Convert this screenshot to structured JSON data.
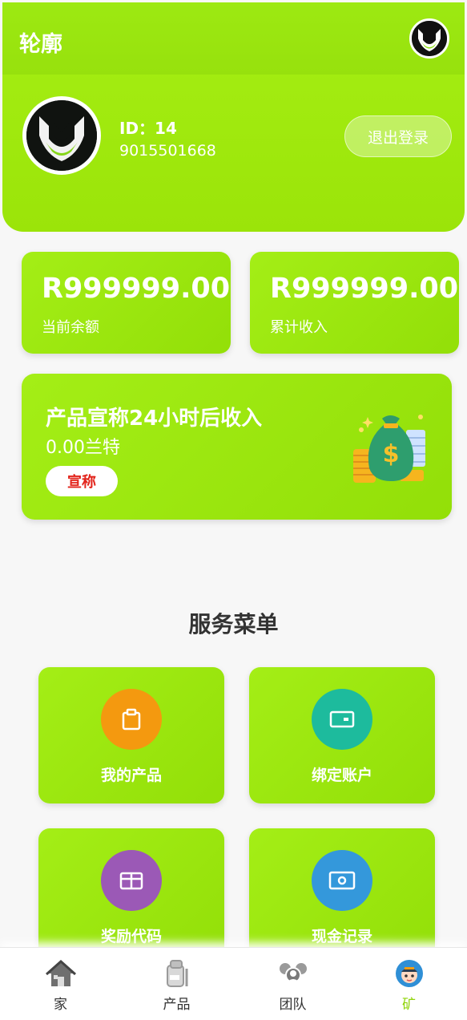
{
  "header": {
    "app_title": "轮廓",
    "user_id": "ID：14",
    "phone": "9015501668",
    "logout_label": "退出登录"
  },
  "balances": [
    {
      "amount": "R999999.00",
      "label": "当前余额"
    },
    {
      "amount": "R999999.00",
      "label": "累计收入"
    }
  ],
  "claim": {
    "title": "产品宣称24小时后收入",
    "amount": "0.00兰特",
    "button_label": "宣称"
  },
  "menu": {
    "title": "服务菜单",
    "items": [
      {
        "label": "我的产品",
        "icon": "clipboard-icon",
        "color": "#f4990f"
      },
      {
        "label": "绑定账户",
        "icon": "wallet-icon",
        "color": "#1dbb9d"
      },
      {
        "label": "奖励代码",
        "icon": "gift-icon",
        "color": "#9b59b6"
      },
      {
        "label": "现金记录",
        "icon": "cash-icon",
        "color": "#3498db"
      }
    ]
  },
  "bottom_nav": {
    "items": [
      {
        "label": "家",
        "icon": "home-icon"
      },
      {
        "label": "产品",
        "icon": "product-icon"
      },
      {
        "label": "团队",
        "icon": "team-icon"
      },
      {
        "label": "矿",
        "icon": "mine-icon",
        "active": true
      }
    ]
  },
  "colors": {
    "brand_green": "#9be409",
    "active_nav": "#8fd40a",
    "claim_button_text": "#e2231a"
  }
}
